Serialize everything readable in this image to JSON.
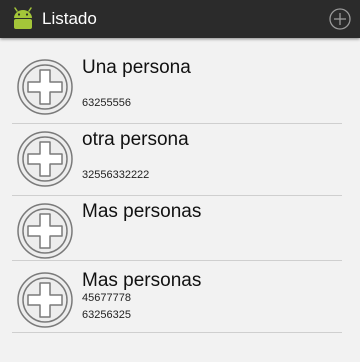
{
  "colors": {
    "action_bar": "#2b2b2b",
    "title_text": "#ffffff",
    "list_background": "#f2f2f2",
    "divider": "#cfcfcf",
    "icon_stroke": "#7a7a7a",
    "android_green": "#a4c639"
  },
  "action_bar": {
    "title": "Listado",
    "logo_icon": "android-logo-icon",
    "action_icon": "add-circle-icon"
  },
  "list": {
    "item_icon": "add-circle-icon",
    "items": [
      {
        "name": "Una persona",
        "phones": [
          "63255556"
        ]
      },
      {
        "name": "otra persona",
        "phones": [
          "32556332222"
        ]
      },
      {
        "name": "Mas personas",
        "phones": []
      },
      {
        "name": "Mas personas",
        "phones": [
          "45677778",
          "63256325"
        ]
      }
    ]
  }
}
